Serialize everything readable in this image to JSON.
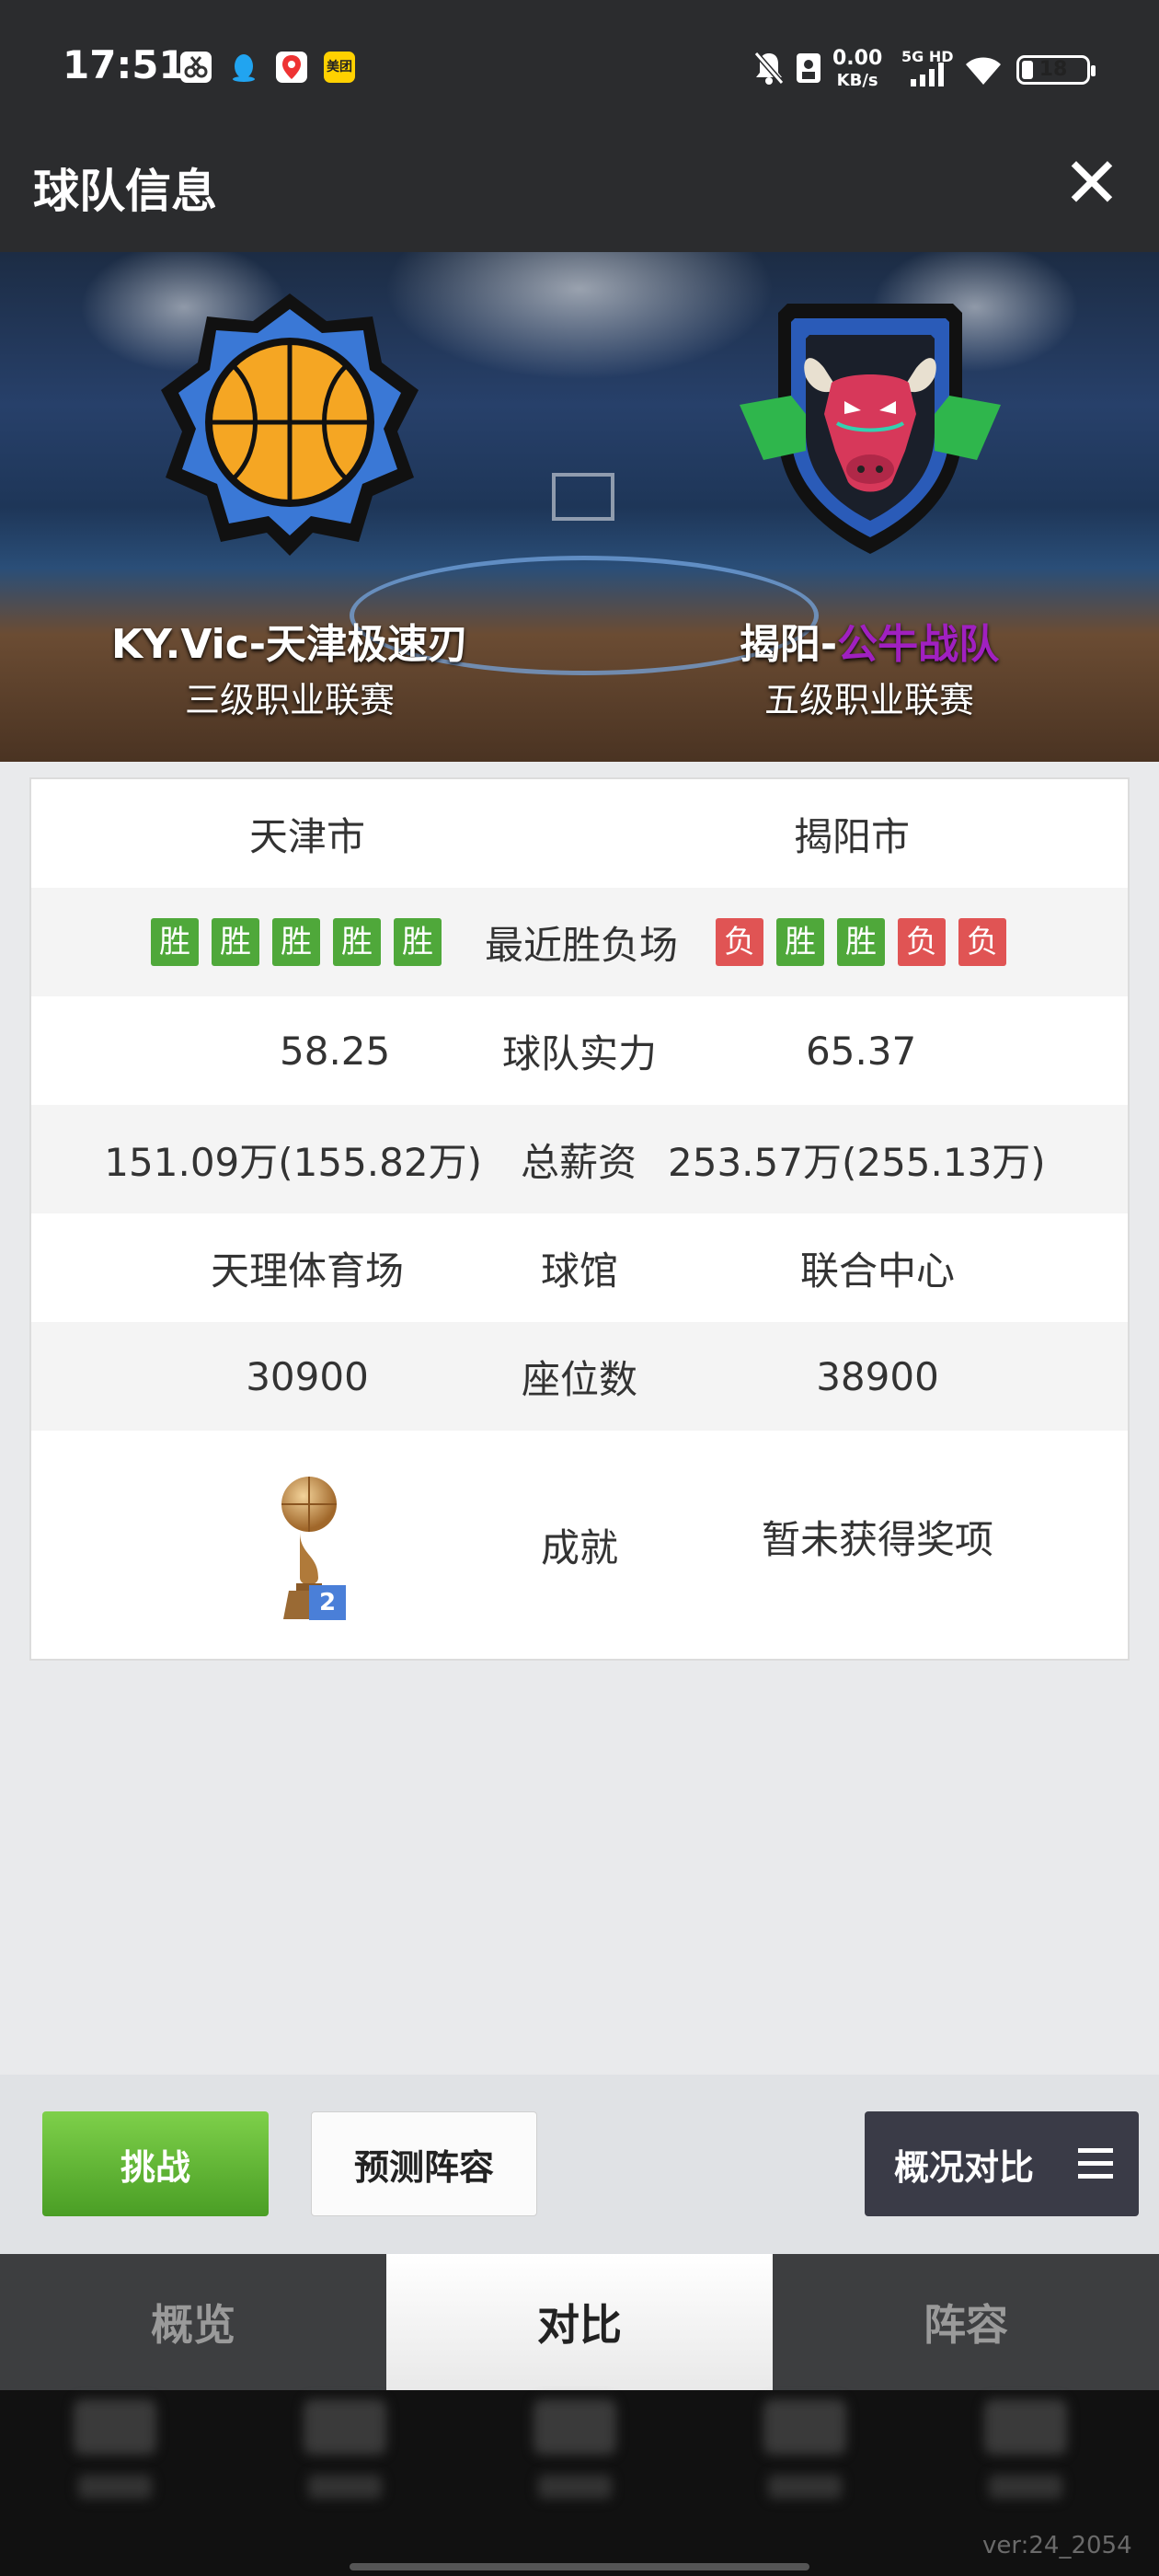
{
  "status_bar": {
    "time": "17:51",
    "net_speed": "0.00",
    "net_unit": "KB/s",
    "signal_label": "5G HD",
    "battery": "18",
    "battery_level": 0.18,
    "app_icons": [
      "scissors-app-icon",
      "qq-app-icon",
      "map-pin-app-icon",
      "meituan-app-icon"
    ],
    "meituan_label": "美团",
    "status_icons": [
      "mute-bell-icon",
      "sim-card-icon",
      "cellular-signal-icon",
      "wifi-icon",
      "battery-icon"
    ]
  },
  "header": {
    "title": "球队信息",
    "close_glyph": "✕"
  },
  "banner": {
    "home": {
      "name": "KY.Vic-天津极速刃",
      "league": "三级职业联赛"
    },
    "away": {
      "name_prefix": "揭阳-",
      "name_highlight": "公牛战队",
      "league": "五级职业联赛"
    }
  },
  "compare": {
    "city": {
      "home": "天津市",
      "away": "揭阳市"
    },
    "recent": {
      "label": "最近胜负场",
      "home": [
        {
          "r": "胜",
          "type": "win"
        },
        {
          "r": "胜",
          "type": "win"
        },
        {
          "r": "胜",
          "type": "win"
        },
        {
          "r": "胜",
          "type": "win"
        },
        {
          "r": "胜",
          "type": "win"
        }
      ],
      "away": [
        {
          "r": "负",
          "type": "loss"
        },
        {
          "r": "胜",
          "type": "win"
        },
        {
          "r": "胜",
          "type": "win"
        },
        {
          "r": "负",
          "type": "loss"
        },
        {
          "r": "负",
          "type": "loss"
        }
      ]
    },
    "strength": {
      "home": "58.25",
      "label": "球队实力",
      "away": "65.37"
    },
    "salary": {
      "home": "151.09万(155.82万)",
      "label": "总薪资",
      "away": "253.57万(255.13万)"
    },
    "arena": {
      "home": "天理体育场",
      "label": "球馆",
      "away": "联合中心"
    },
    "seats": {
      "home": "30900",
      "label": "座位数",
      "away": "38900"
    },
    "achievement": {
      "label": "成就",
      "home_trophy_count": "2",
      "away": "暂未获得奖项"
    }
  },
  "actions": {
    "challenge": "挑战",
    "predict": "预测阵容",
    "compare": "概况对比"
  },
  "tabs": [
    {
      "label": "概览",
      "active": false
    },
    {
      "label": "对比",
      "active": true
    },
    {
      "label": "阵容",
      "active": false
    }
  ],
  "version": "ver:24_2054",
  "colors": {
    "win": "#4fa83a",
    "loss": "#e05454",
    "highlight_purple": "#a020c0",
    "header_bg": "#2b2c2e"
  }
}
